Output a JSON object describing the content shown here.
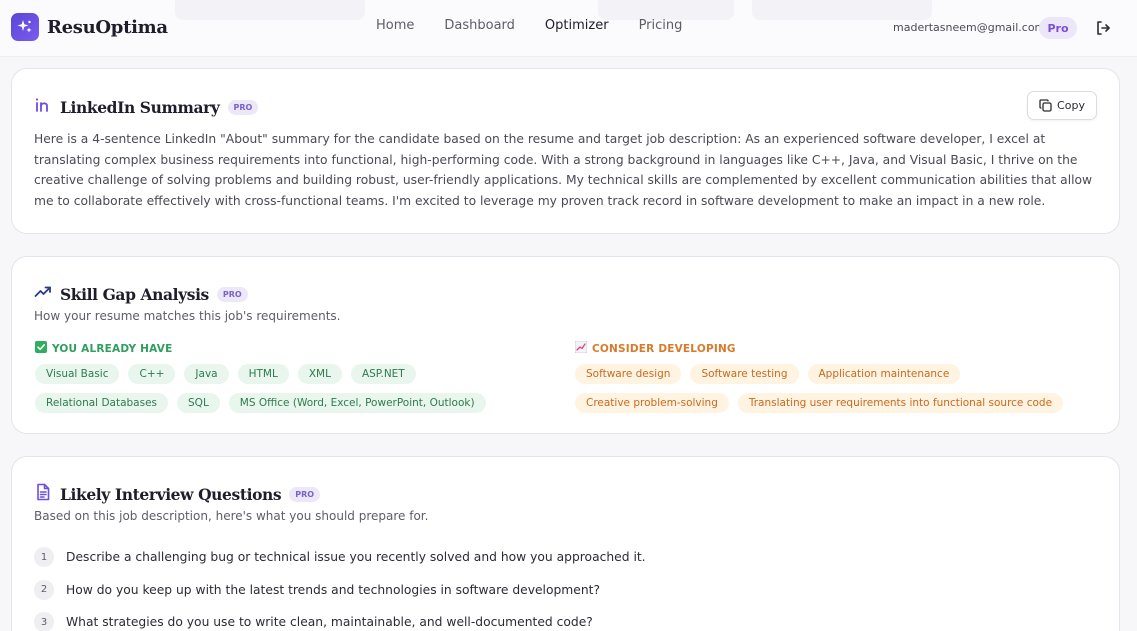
{
  "nav": {
    "brand": "ResuOptima",
    "links": [
      {
        "label": "Home"
      },
      {
        "label": "Dashboard"
      },
      {
        "label": "Optimizer"
      },
      {
        "label": "Pricing"
      }
    ],
    "active_link": "Optimizer",
    "user_email": "madertasneem@gmail.com",
    "plan_badge": "Pro"
  },
  "linkedin": {
    "title": "LinkedIn Summary",
    "badge": "PRO",
    "copy_label": "Copy",
    "summary": "Here is a 4-sentence LinkedIn \"About\" summary for the candidate based on the resume and target job description: As an experienced software developer, I excel at translating complex business requirements into functional, high-performing code. With a strong background in languages like C++, Java, and Visual Basic, I thrive on the creative challenge of solving problems and building robust, user-friendly applications. My technical skills are complemented by excellent communication abilities that allow me to collaborate effectively with cross-functional teams. I'm excited to leverage my proven track record in software development to make an impact in a new role."
  },
  "skills": {
    "title": "Skill Gap Analysis",
    "badge": "PRO",
    "subtitle": "How your resume matches this job's requirements.",
    "have_heading": "YOU ALREADY HAVE",
    "have": [
      "Visual Basic",
      "C++",
      "Java",
      "HTML",
      "XML",
      "ASP.NET",
      "Relational Databases",
      "SQL",
      "MS Office (Word, Excel, PowerPoint, Outlook)"
    ],
    "develop_heading": "CONSIDER DEVELOPING",
    "develop": [
      "Software design",
      "Software testing",
      "Application maintenance",
      "Creative problem-solving",
      "Translating user requirements into functional source code"
    ]
  },
  "interview": {
    "title": "Likely Interview Questions",
    "badge": "PRO",
    "subtitle": "Based on this job description, here's what you should prepare for.",
    "questions": [
      {
        "num": "1",
        "text": "Describe a challenging bug or technical issue you recently solved and how you approached it."
      },
      {
        "num": "2",
        "text": "How do you keep up with the latest trends and technologies in software development?"
      },
      {
        "num": "3",
        "text": "What strategies do you use to write clean, maintainable, and well-documented code?"
      }
    ]
  },
  "colors": {
    "accent": "#6a4fe0",
    "have": "#2f9e5e",
    "develop": "#d97a2a"
  }
}
